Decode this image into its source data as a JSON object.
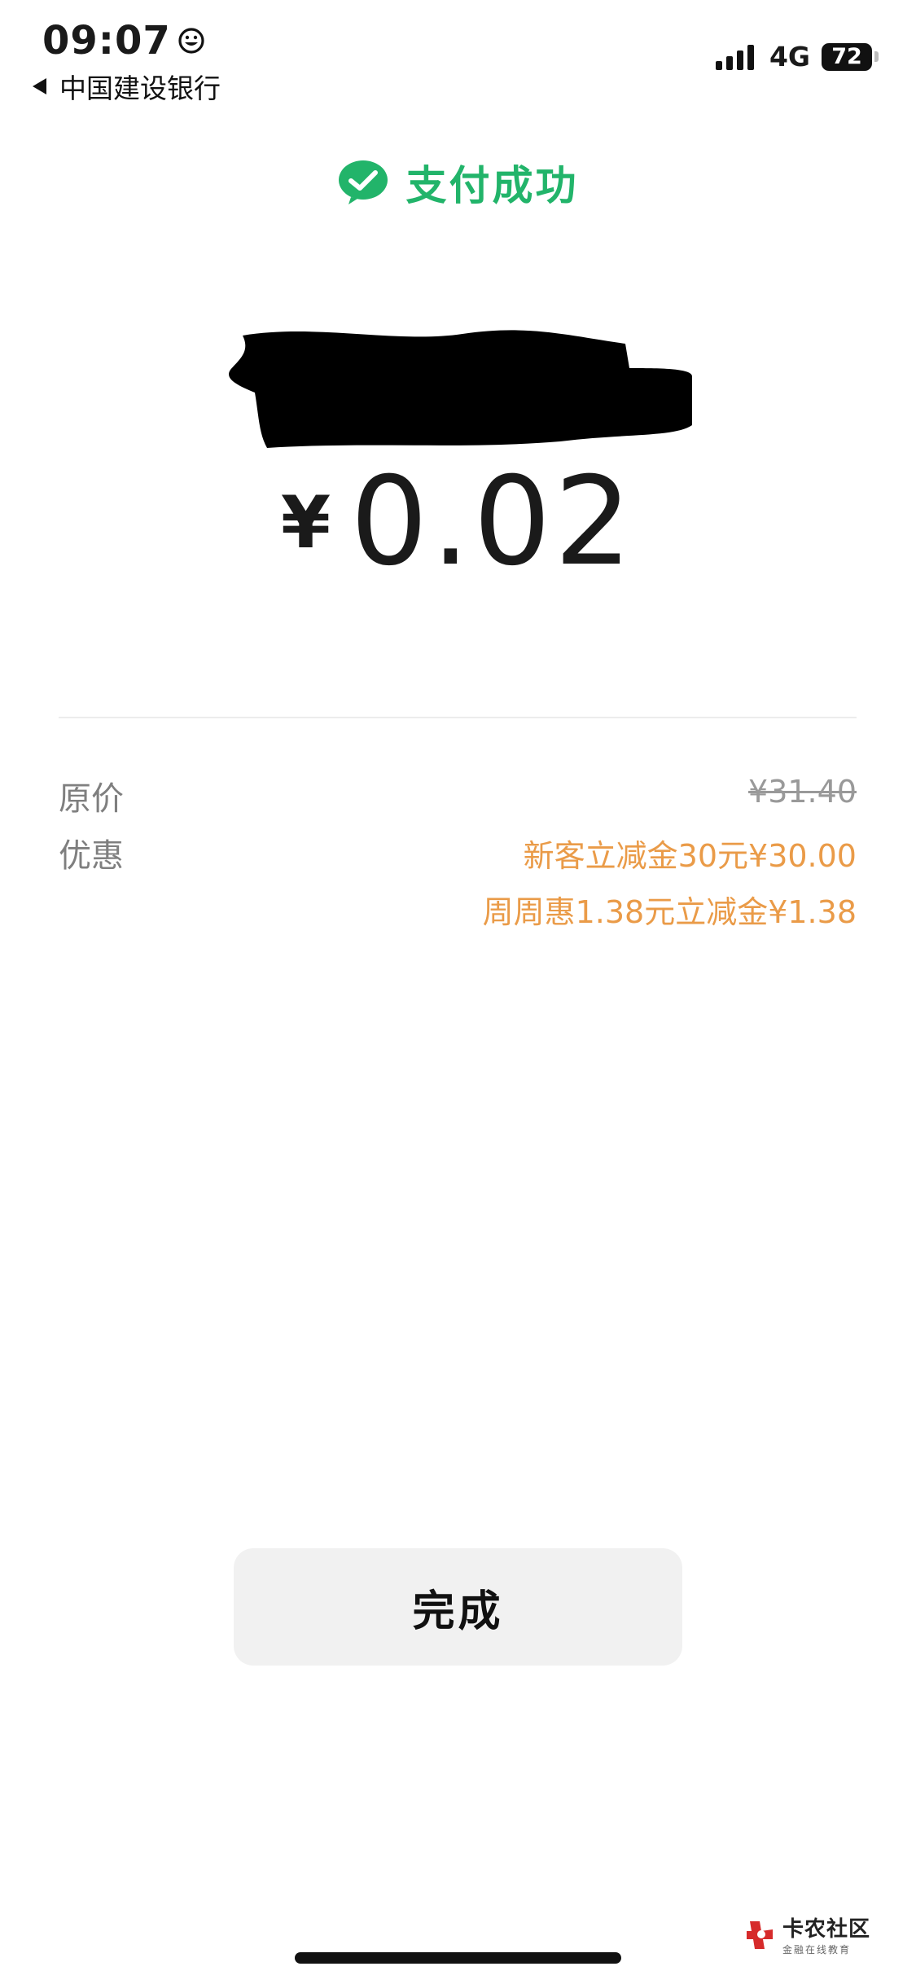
{
  "status_bar": {
    "time": "09:07",
    "back_label": "中国建设银行",
    "network": "4G",
    "battery": "72"
  },
  "header": {
    "title": "支付成功"
  },
  "payment": {
    "currency": "¥",
    "amount": "0.02"
  },
  "details": {
    "original_label": "原价",
    "original_value": "¥31.40",
    "discount_label": "优惠",
    "discounts": [
      "新客立减金30元¥30.00",
      "周周惠1.38元立减金¥1.38"
    ]
  },
  "actions": {
    "done_label": "完成"
  },
  "watermark": {
    "name": "卡农社区",
    "tagline": "金融在线教育"
  },
  "colors": {
    "success_green": "#22b46a",
    "discount_orange": "#ea9b48",
    "button_bg": "#f1f1f1"
  }
}
